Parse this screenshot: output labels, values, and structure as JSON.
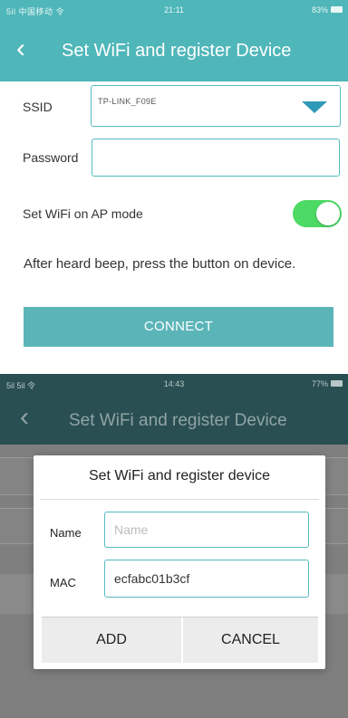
{
  "screen1": {
    "status_bar": {
      "carrier": "5il 中国移动 令",
      "time": "21:11",
      "battery": "83%"
    },
    "app_bar": {
      "back_glyph": "‹",
      "title": "Set WiFi and register Device"
    },
    "ssid": {
      "label": "SSID",
      "value": "TP-LINK_F09E"
    },
    "password": {
      "label": "Password",
      "value": ""
    },
    "ap_mode": {
      "label": "Set WiFi on AP mode",
      "enabled": true
    },
    "instruction": "After heard beep, press the button on device.",
    "connect_label": "CONNECT"
  },
  "screen2": {
    "status_bar": {
      "carrier": "5il 5il 令",
      "time": "14:43",
      "battery": "77%"
    },
    "app_bar": {
      "back_glyph": "‹",
      "title": "Set WiFi and register Device"
    },
    "dialog": {
      "title": "Set WiFi and register device",
      "name": {
        "label": "Name",
        "placeholder": "Name",
        "value": ""
      },
      "mac": {
        "label": "MAC",
        "value": "ecfabc01b3cf"
      },
      "add_label": "ADD",
      "cancel_label": "CANCEL"
    }
  },
  "colors": {
    "accent_teal": "#4fb6b9",
    "dim_teal": "#2a4f52",
    "toggle_on": "#4cd964",
    "dropdown_arrow": "#2f9ab8"
  }
}
